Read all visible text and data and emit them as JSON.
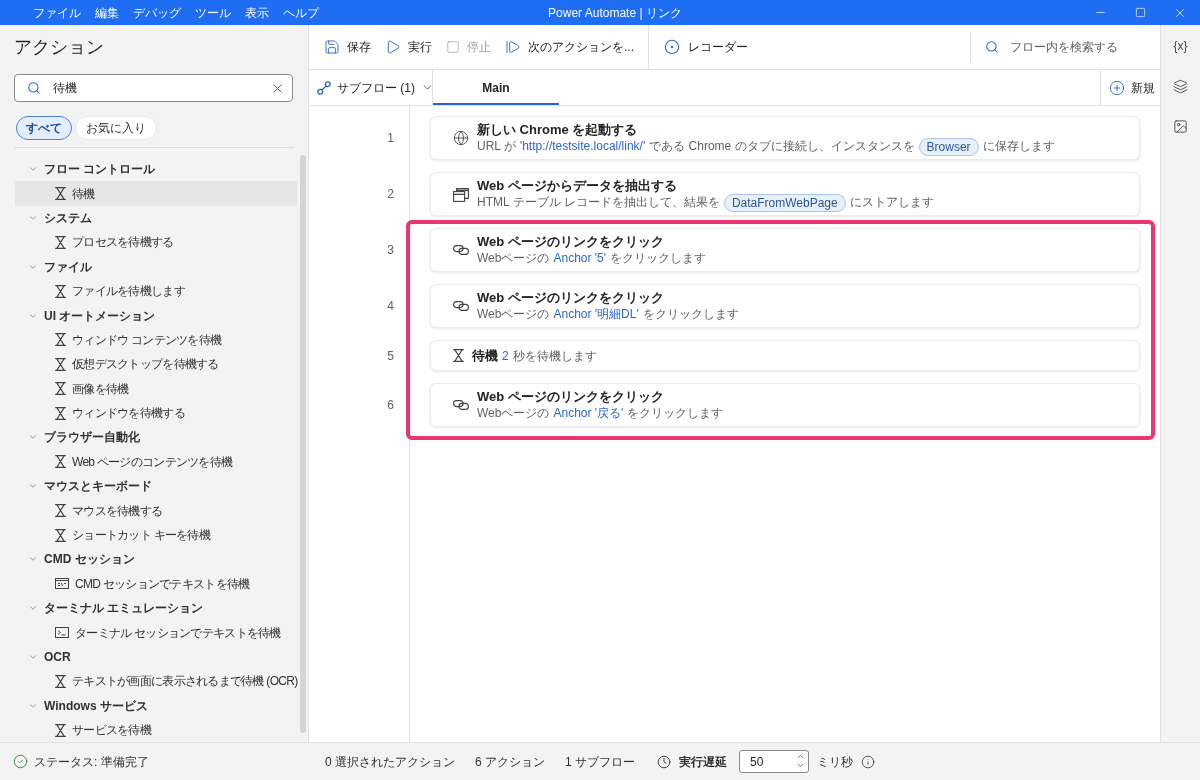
{
  "window": {
    "title": "Power Automate | リンク"
  },
  "menu": [
    "ファイル",
    "編集",
    "デバッグ",
    "ツール",
    "表示",
    "ヘルプ"
  ],
  "actions_panel": {
    "title": "アクション",
    "search": {
      "value": "待機"
    },
    "filters": [
      {
        "label": "すべて",
        "selected": true
      },
      {
        "label": "お気に入り",
        "selected": false
      }
    ],
    "tree": [
      {
        "label": "フロー コントロール",
        "expanded": true,
        "children": [
          {
            "label": "待機",
            "kind": "wait",
            "selected": true
          }
        ]
      },
      {
        "label": "システム",
        "expanded": true,
        "children": [
          {
            "label": "プロセスを待機する",
            "kind": "wait",
            "selected": false
          }
        ]
      },
      {
        "label": "ファイル",
        "expanded": true,
        "children": [
          {
            "label": "ファイルを待機します",
            "kind": "wait",
            "selected": false
          }
        ]
      },
      {
        "label": "UI オートメーション",
        "expanded": true,
        "children": [
          {
            "label": "ウィンドウ コンテンツを待機",
            "kind": "wait",
            "selected": false
          },
          {
            "label": "仮想デスクトップを待機する",
            "kind": "wait",
            "selected": false
          },
          {
            "label": "画像を待機",
            "kind": "wait",
            "selected": false
          },
          {
            "label": "ウィンドウを待機する",
            "kind": "wait",
            "selected": false
          }
        ]
      },
      {
        "label": "ブラウザー自動化",
        "expanded": true,
        "children": [
          {
            "label": "Web ページのコンテンツを待機",
            "kind": "wait",
            "selected": false
          }
        ]
      },
      {
        "label": "マウスとキーボード",
        "expanded": true,
        "children": [
          {
            "label": "マウスを待機する",
            "kind": "wait",
            "selected": false
          },
          {
            "label": "ショートカット キーを待機",
            "kind": "wait",
            "selected": false
          }
        ]
      },
      {
        "label": "CMD セッション",
        "expanded": true,
        "children": [
          {
            "label": "CMD セッションでテキストを待機",
            "kind": "cmd",
            "selected": false
          }
        ]
      },
      {
        "label": "ターミナル エミュレーション",
        "expanded": true,
        "children": [
          {
            "label": "ターミナル セッションでテキストを待機",
            "kind": "terminal",
            "selected": false
          }
        ]
      },
      {
        "label": "OCR",
        "expanded": true,
        "children": [
          {
            "label": "テキストが画面に表示されるまで待機 (OCR)",
            "kind": "wait",
            "selected": false
          }
        ]
      },
      {
        "label": "Windows サービス",
        "expanded": true,
        "children": [
          {
            "label": "サービスを待機",
            "kind": "wait",
            "selected": false
          }
        ]
      }
    ]
  },
  "toolbar": {
    "buttons": [
      {
        "kind": "save",
        "label": "保存",
        "disabled": false
      },
      {
        "kind": "run",
        "label": "実行",
        "disabled": false
      },
      {
        "kind": "stop",
        "label": "停止",
        "disabled": true
      },
      {
        "kind": "run_next",
        "label": "次のアクションを...",
        "disabled": false
      }
    ],
    "recorder": {
      "label": "レコーダー"
    },
    "search": {
      "placeholder": "フロー内を検索する"
    }
  },
  "tabs_bar": {
    "subflows": {
      "label": "サブフロー (1)"
    },
    "tabs": [
      {
        "label": "Main",
        "selected": true
      }
    ],
    "new_button": {
      "label": "新規"
    }
  },
  "steps": [
    {
      "number": "1",
      "kind": "launch_browser",
      "title": "新しい Chrome を起動する",
      "highlighted": false,
      "description": [
        {
          "kind": "text",
          "text": "URL が"
        },
        {
          "kind": "value",
          "text": "'http://testsite.local/link/'"
        },
        {
          "kind": "text",
          "text": "である Chrome のタブに接続し、インスタンスを"
        },
        {
          "kind": "variable",
          "text": "Browser"
        },
        {
          "kind": "text",
          "text": "に保存します"
        }
      ]
    },
    {
      "number": "2",
      "kind": "extract_data",
      "title": "Web ページからデータを抽出する",
      "highlighted": false,
      "description": [
        {
          "kind": "text",
          "text": "HTML テーブル レコードを抽出して、結果を"
        },
        {
          "kind": "variable",
          "text": "DataFromWebPage"
        },
        {
          "kind": "text",
          "text": "にストアします"
        }
      ]
    },
    {
      "number": "3",
      "kind": "click_link",
      "title": "Web ページのリンクをクリック",
      "highlighted": true,
      "description": [
        {
          "kind": "text",
          "text": "Webページの"
        },
        {
          "kind": "value",
          "text": "Anchor '5'"
        },
        {
          "kind": "text",
          "text": "をクリックします"
        }
      ]
    },
    {
      "number": "4",
      "kind": "click_link",
      "title": "Web ページのリンクをクリック",
      "highlighted": true,
      "description": [
        {
          "kind": "text",
          "text": "Webページの"
        },
        {
          "kind": "value",
          "text": "Anchor '明細DL'"
        },
        {
          "kind": "text",
          "text": "をクリックします"
        }
      ]
    },
    {
      "number": "5",
      "kind": "wait",
      "title": "待機",
      "highlighted": true,
      "description": [
        {
          "kind": "value",
          "text": "2"
        },
        {
          "kind": "text",
          "text": "秒を待機します"
        }
      ]
    },
    {
      "number": "6",
      "kind": "click_link",
      "title": "Web ページのリンクをクリック",
      "highlighted": true,
      "description": [
        {
          "kind": "text",
          "text": "Webページの"
        },
        {
          "kind": "value",
          "text": "Anchor '戻る'"
        },
        {
          "kind": "text",
          "text": "をクリックします"
        }
      ]
    }
  ],
  "side_rail": {
    "variables": "{x}"
  },
  "status_bar": {
    "status": "ステータス: 準備完了",
    "selected_actions": "0 選択されたアクション",
    "actions": "6 アクション",
    "subflows": "1 サブフロー",
    "delay_label": "実行遅延",
    "delay": {
      "value": "50"
    },
    "delay_unit": "ミリ秒"
  }
}
